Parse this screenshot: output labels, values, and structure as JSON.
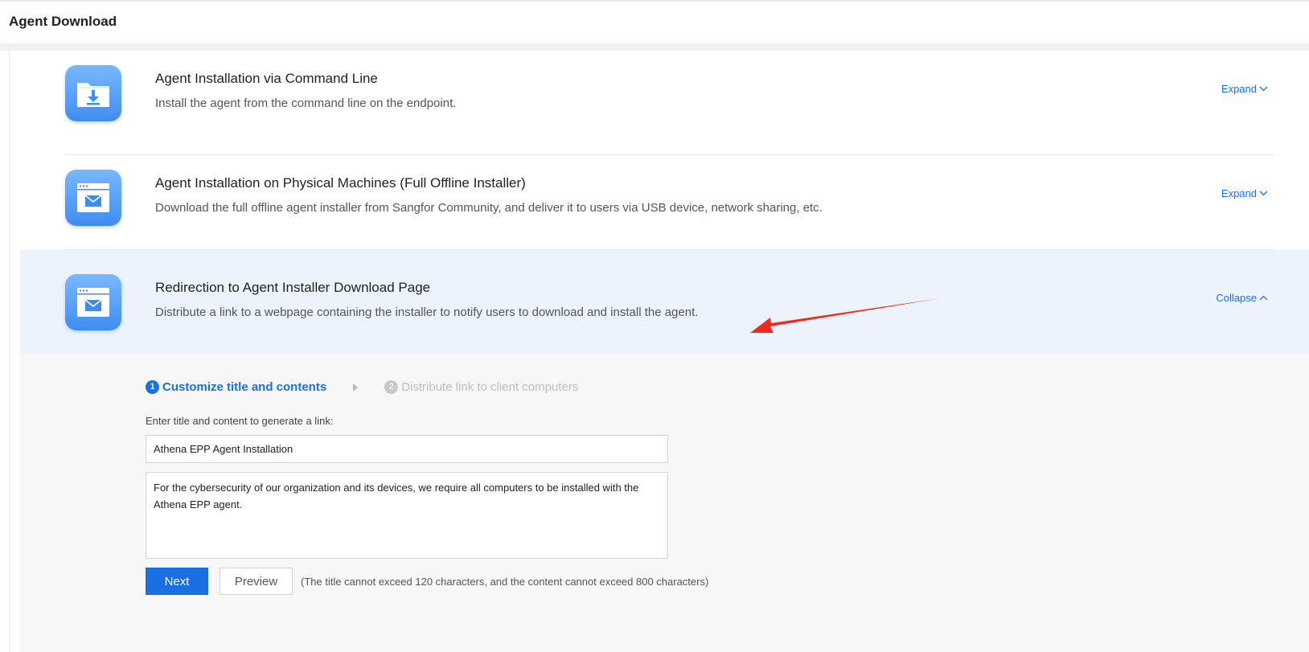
{
  "page": {
    "title": "Agent Download"
  },
  "cards": [
    {
      "title": "Agent Installation via Command Line",
      "description": "Install the agent from the command line on the endpoint.",
      "toggle_label": "Expand",
      "icon": "folder-download-icon"
    },
    {
      "title": "Agent Installation on Physical Machines (Full Offline Installer)",
      "description": "Download the full offline agent installer from Sangfor Community, and deliver it to users via USB device, network sharing, etc.",
      "toggle_label": "Expand",
      "icon": "browser-mail-icon"
    },
    {
      "title": "Redirection to Agent Installer Download Page",
      "description": "Distribute a link to a webpage containing the installer to notify users to download and install the agent.",
      "toggle_label": "Collapse",
      "icon": "browser-mail-icon"
    }
  ],
  "wizard": {
    "steps": [
      {
        "num": "1",
        "label": "Customize title and contents"
      },
      {
        "num": "2",
        "label": "Distribute link to client computers"
      }
    ],
    "form_label": "Enter title and content to generate a link:",
    "title_value": "Athena EPP Agent Installation",
    "content_value": "For the cybersecurity of our organization and its devices, we require all computers to be installed with the Athena EPP agent.",
    "next_label": "Next",
    "preview_label": "Preview",
    "hint": "(The title cannot exceed 120 characters, and the content cannot exceed 800 characters)"
  },
  "colors": {
    "accent": "#1a6fe3",
    "active_row": "#edf3fc",
    "annotation": "#f02a1a"
  }
}
